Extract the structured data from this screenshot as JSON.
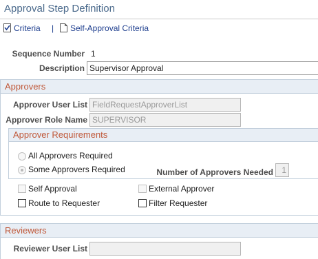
{
  "page_title": "Approval Step Definition",
  "toolbar": {
    "criteria_label": "Criteria",
    "separator": "|",
    "self_approval_criteria_label": "Self-Approval Criteria"
  },
  "step": {
    "sequence_number_label": "Sequence Number",
    "sequence_number_value": "1",
    "description_label": "Description",
    "description_value": "Supervisor Approval"
  },
  "approvers": {
    "heading": "Approvers",
    "user_list_label": "Approver User List",
    "user_list_value": "FieldRequestApproverList",
    "role_name_label": "Approver Role Name",
    "role_name_value": "SUPERVISOR",
    "requirements": {
      "heading": "Approver Requirements",
      "all_required_label": "All Approvers Required",
      "some_required_label": "Some Approvers Required",
      "selected": "Some Approvers Required",
      "number_needed_label": "Number of Approvers Needed",
      "number_needed_value": "1"
    },
    "options": {
      "self_approval_label": "Self Approval",
      "external_approver_label": "External Approver",
      "route_to_requester_label": "Route to Requester",
      "filter_requester_label": "Filter Requester"
    }
  },
  "reviewers": {
    "heading": "Reviewers",
    "user_list_label": "Reviewer User List",
    "user_list_value": ""
  },
  "colors": {
    "title": "#4b6a8c",
    "link": "#1f3f8f",
    "section_heading_text": "#c0593a",
    "section_heading_bg": "#e8eef5"
  }
}
